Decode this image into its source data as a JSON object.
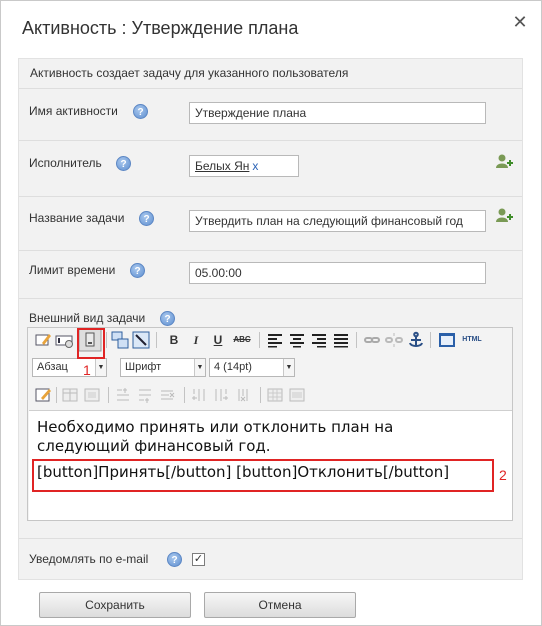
{
  "dialog": {
    "title": "Активность : Утверждение плана",
    "close_glyph": "✕"
  },
  "form": {
    "description": "Активность создает задачу для указанного пользователя",
    "activity_name": {
      "label": "Имя активности",
      "value": "Утверждение плана"
    },
    "performer": {
      "label": "Исполнитель",
      "user": "Белых Ян",
      "remove": "x"
    },
    "task_name": {
      "label": "Название задачи",
      "value": "Утвердить план на следующий финансовый год"
    },
    "time_limit": {
      "label": "Лимит времени",
      "value": "05.00:00"
    },
    "task_view": {
      "label": "Внешний вид задачи"
    },
    "notify": {
      "label": "Уведомлять по e-mail",
      "checked": true,
      "check_glyph": "✓"
    },
    "help_glyph": "?"
  },
  "editor": {
    "toolbar": {
      "bold": "B",
      "italic": "I",
      "underline": "U",
      "strike": "ABC",
      "html": "HTML",
      "format_select": "Абзац",
      "font_select": "Шрифт",
      "size_select": "4 (14pt)",
      "dropdown_arrow": "▼"
    },
    "content": {
      "paragraph": "Необходимо принять или отклонить план на следующий финансовый год.",
      "buttons_line": "[button]Принять[/button]   [button]Отклонить[/button]"
    },
    "annotations": {
      "marker_1": "1",
      "marker_2": "2"
    }
  },
  "footer": {
    "save_label": "Сохранить",
    "cancel_label": "Отмена"
  },
  "colors": {
    "annotation_red": "#e02424",
    "help_blue": "#5f8fd0",
    "panel_bg": "#f2f2f2"
  }
}
